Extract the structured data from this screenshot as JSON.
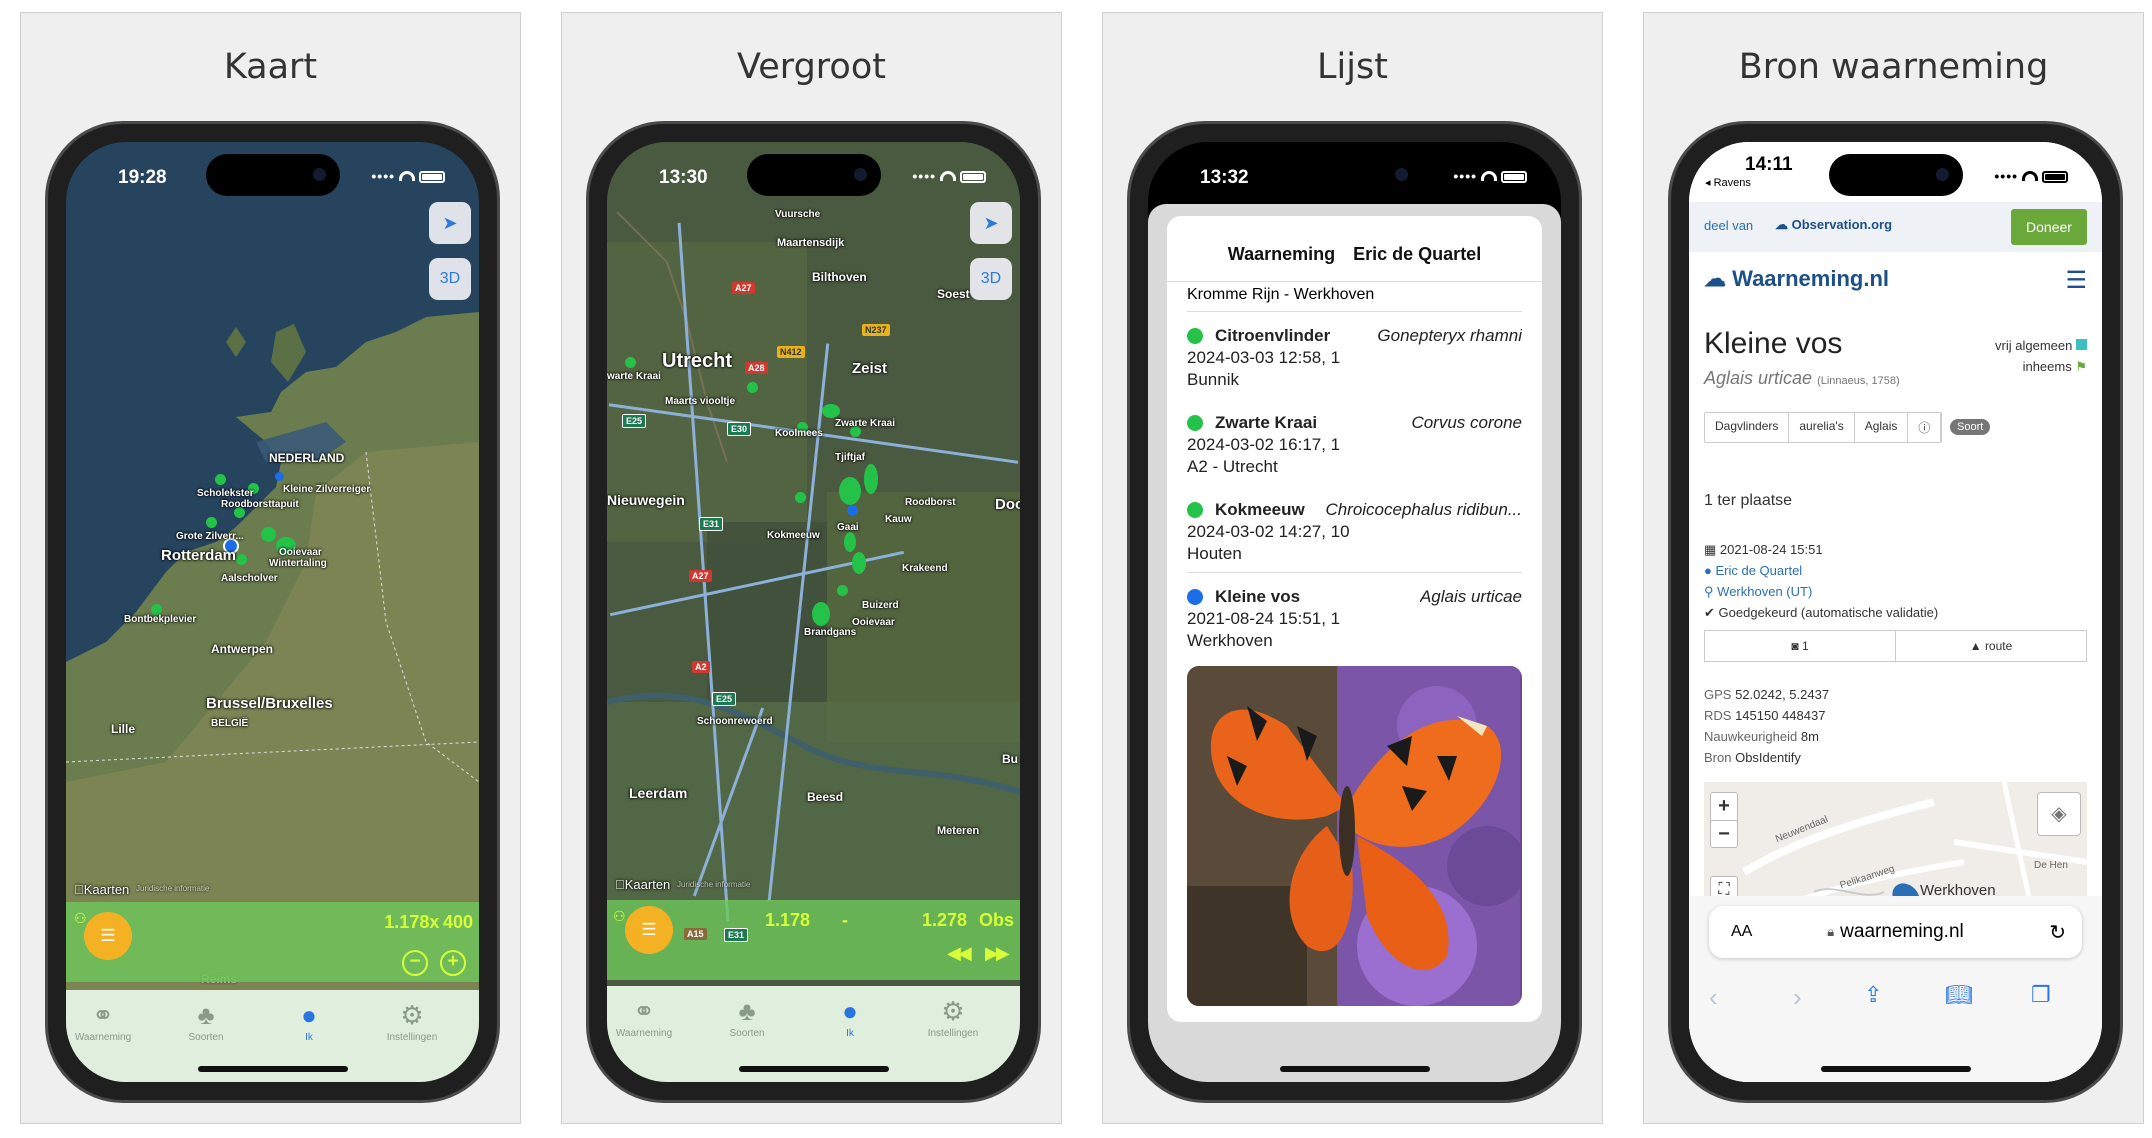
{
  "panels": [
    {
      "title": "Kaart"
    },
    {
      "title": "Vergroot"
    },
    {
      "title": "Lijst"
    },
    {
      "title": "Bron waarneming"
    }
  ],
  "tabs": [
    "Waarneming",
    "Soorten",
    "Ik",
    "Instellingen"
  ],
  "kaart": {
    "time": "19:28",
    "btn_3d": "3D",
    "labels": [
      "NEDERLAND",
      "Scholekster",
      "Roodborsttapuit",
      "Kleine Zilverreiger",
      "Grote Zilverr...",
      "Rotterdam",
      "Ooievaar",
      "Wintertaling",
      "Aalscholver",
      "Bontbekplevier",
      "Antwerpen",
      "Brussel/Bruxelles",
      "BELGIË",
      "Lille",
      "Reims"
    ],
    "attribution": "Kaarten",
    "legal": "Juridische informatie",
    "zoom": "1.178x 400"
  },
  "vergroot": {
    "time": "13:30",
    "btn_3d": "3D",
    "labels": [
      "Maartensdijk",
      "Bilthoven",
      "Soest",
      "Utrecht",
      "Zeist",
      "Maarts viooltje",
      "Koolmees",
      "Zwarte Kraai",
      "Tjiftjaf",
      "Roodborst",
      "Kauw",
      "Nieuwegein",
      "Kokmeeuw",
      "Gaai",
      "Krakeend",
      "Buizerd",
      "Ooievaar",
      "Brandgans",
      "Schoonrewoerd",
      "Leerdam",
      "Beesd",
      "Meteren",
      "Doorn",
      "Bu",
      "Vuursche",
      "warte Kraai"
    ],
    "roads": [
      "A27",
      "A28",
      "N412",
      "N237",
      "E25",
      "E30",
      "E31",
      "A27",
      "A2",
      "E25",
      "E31",
      "A15"
    ],
    "attribution": "Kaarten",
    "legal": "Juridische informatie",
    "zoom_left": "1.178",
    "zoom_sep": "-",
    "zoom_right": "1.278",
    "obs": "Obs"
  },
  "lijst": {
    "time": "13:32",
    "header": "Waarneming Eric de Quartel",
    "top_location": "Kromme Rijn - Werkhoven",
    "items": [
      {
        "name": "Citroenvlinder",
        "sci": "Gonepteryx rhamni",
        "line2": "2024-03-03 12:58, 1",
        "line3": "Bunnik",
        "color": "#25c24a"
      },
      {
        "name": "Zwarte Kraai",
        "sci": "Corvus corone",
        "line2": "2024-03-02 16:17, 1",
        "line3": "A2 - Utrecht",
        "color": "#25c24a"
      },
      {
        "name": "Kokmeeuw",
        "sci": "Chroicocephalus ridibun...",
        "line2": "2024-03-02 14:27, 10",
        "line3": "Houten",
        "color": "#25c24a"
      },
      {
        "name": "Kleine vos",
        "sci": "Aglais urticae",
        "line2": "2021-08-24 15:51, 1",
        "line3": "Werkhoven",
        "color": "#1c6ee8"
      }
    ]
  },
  "bron": {
    "time": "14:11",
    "back": "◂ Ravens",
    "deel_van": "deel van",
    "observation": "Observation.org",
    "doneer": "Doneer",
    "logo": "Waarneming.nl",
    "species": "Kleine vos",
    "sci": "Aglais urticae",
    "author": "(Linnaeus, 1758)",
    "status1": "vrij algemeen",
    "status2": "inheems",
    "tags": [
      "Dagvlinders",
      "aurelia's",
      "Aglais",
      "ⓘ"
    ],
    "soort": "Soort",
    "count": "1 ter plaatse",
    "date": "2021-08-24 15:51",
    "observer": "Eric de Quartel",
    "place": "Werkhoven (UT)",
    "validation": "Goedgekeurd (automatische validatie)",
    "photos": "1",
    "route": "route",
    "gps_label": "GPS",
    "gps": "52.0242, 5.2437",
    "rds_label": "RDS",
    "rds": "145150 448437",
    "acc_label": "Nauwkeurigheid",
    "acc": "8m",
    "src_label": "Bron",
    "src": "ObsIdentify",
    "map_labels": [
      "Neuwendaal",
      "Pelikaanweg",
      "Werkhoven",
      "De Hen"
    ],
    "aa": "AA",
    "url": "waarneming.nl",
    "zoom_plus": "+",
    "zoom_minus": "−"
  },
  "colors": {
    "fab": "#f4b124",
    "zoom_text": "#d6ff3a",
    "observed": "#25c24a",
    "own": "#1c6ee8",
    "doneer": "#6aa83b"
  }
}
